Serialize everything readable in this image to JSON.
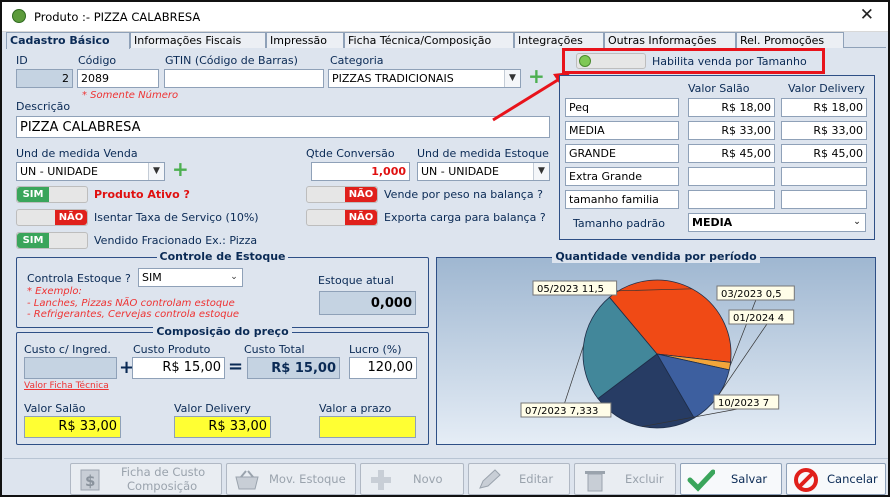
{
  "window": {
    "title": "Produto :- PIZZA CALABRESA",
    "close_icon": "close-icon"
  },
  "tabs": [
    "Cadastro Básico",
    "Informações Fiscais",
    "Impressão",
    "Ficha Técnica/Composição",
    "Integrações",
    "Outras Informações",
    "Rel. Promoções"
  ],
  "fields": {
    "id_label": "ID",
    "id_value": "2",
    "codigo_label": "Código",
    "codigo_value": "2089",
    "codigo_note": "* Somente Número",
    "gtin_label": "GTIN (Código de Barras)",
    "gtin_value": "",
    "categoria_label": "Categoria",
    "categoria_value": "PIZZAS TRADICIONAIS",
    "descricao_label": "Descrição",
    "descricao_value": "PIZZA CALABRESA",
    "und_venda_label": "Und de medida Venda",
    "und_venda_value": "UN - UNIDADE",
    "qtde_conv_label": "Qtde Conversão",
    "qtde_conv_value": "1,000",
    "und_estoque_label": "Und de medida Estoque",
    "und_estoque_value": "UN - UNIDADE"
  },
  "toggles": {
    "sim": "SIM",
    "nao": "NÃO",
    "produto_ativo": "Produto Ativo ?",
    "isentar_taxa": "Isentar Taxa de Serviço (10%)",
    "vendido_fracionado": "Vendido Fracionado Ex.: Pizza",
    "vende_peso": "Vende por peso na balança ?",
    "exporta_carga": "Exporta carga para balança ?",
    "habilita_tamanho": "Habilita venda por Tamanho"
  },
  "sizes": {
    "col_salao": "Valor Salão",
    "col_delivery": "Valor Delivery",
    "rows": [
      {
        "name": "Peq",
        "salao": "R$ 18,00",
        "delivery": "R$ 18,00"
      },
      {
        "name": "MEDIA",
        "salao": "R$ 33,00",
        "delivery": "R$ 33,00"
      },
      {
        "name": "GRANDE",
        "salao": "R$ 45,00",
        "delivery": "R$ 45,00"
      },
      {
        "name": "Extra Grande",
        "salao": "",
        "delivery": ""
      },
      {
        "name": "tamanho familia",
        "salao": "",
        "delivery": ""
      }
    ],
    "padrao_label": "Tamanho padrão",
    "padrao_value": "MEDIA"
  },
  "estoque": {
    "title": "Controle de Estoque",
    "controla_label": "Controla Estoque ?",
    "controla_value": "SIM",
    "atual_label": "Estoque atual",
    "atual_value": "0,000",
    "note1": "* Exemplo:",
    "note2": "- Lanches, Pizzas NÃO controlam estoque",
    "note3": "- Refrigerantes, Cervejas controla estoque"
  },
  "preco": {
    "title": "Composição do preço",
    "custo_ingred_label": "Custo c/ Ingred.",
    "custo_ingred_value": "",
    "custo_prod_label": "Custo Produto",
    "custo_prod_value": "R$ 15,00",
    "custo_total_label": "Custo Total",
    "custo_total_value": "R$ 15,00",
    "lucro_label": "Lucro (%)",
    "lucro_value": "120,00",
    "plus_sign": "+",
    "equals_sign": "=",
    "ficha_link": "Valor Ficha Técnica",
    "salao_label": "Valor Salão",
    "salao_value": "R$ 33,00",
    "delivery_label": "Valor Delivery",
    "delivery_value": "R$ 33,00",
    "prazo_label": "Valor a prazo",
    "prazo_value": ""
  },
  "chart_data": {
    "type": "pie",
    "title": "Quantidade vendida por período",
    "slices": [
      {
        "label": "05/2023",
        "value": 11.5,
        "text": "05/2023 11,5",
        "color": "#f04a15"
      },
      {
        "label": "03/2023",
        "value": 0.5,
        "text": "03/2023 0,5",
        "color": "#f2a53a"
      },
      {
        "label": "01/2024",
        "value": 4,
        "text": "01/2024 4",
        "color": "#3d5f9f"
      },
      {
        "label": "10/2023",
        "value": 7,
        "text": "10/2023 7",
        "color": "#273c64"
      },
      {
        "label": "07/2023",
        "value": 7.333,
        "text": "07/2023 7,333",
        "color": "#42879a"
      }
    ]
  },
  "toolbar": {
    "ficha_custo": "Ficha de Custo",
    "composicao": "Composição",
    "mov_estoque": "Mov. Estoque",
    "novo": "Novo",
    "editar": "Editar",
    "excluir": "Excluir",
    "salvar": "Salvar",
    "cancelar": "Cancelar"
  },
  "colors": {
    "accent_red": "#e8131b",
    "highlight_yellow": "#ffff33",
    "ok_green": "#3aa55b"
  }
}
